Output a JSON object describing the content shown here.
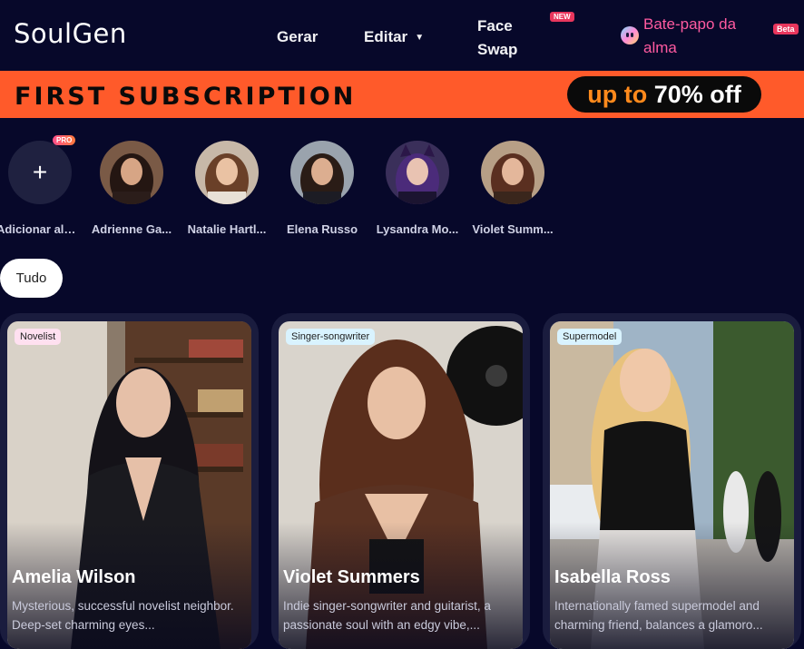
{
  "header": {
    "logo": "SoulGen",
    "nav": {
      "gerar": "Gerar",
      "editar": "Editar",
      "face_swap": "Face Swap",
      "new_badge": "NEW",
      "soul_chat": "Bate-papo da alma",
      "beta_badge": "Beta"
    }
  },
  "banner": {
    "title": "FIRST SUBSCRIPTION",
    "pill_prefix": "up to",
    "pill_value": " 70% off"
  },
  "avatars": {
    "add_label": "Adicionar alm...",
    "pro_badge": "PRO",
    "items": [
      {
        "name": "Adrienne Ga..."
      },
      {
        "name": "Natalie Hartl..."
      },
      {
        "name": "Elena Russo"
      },
      {
        "name": "Lysandra Mo..."
      },
      {
        "name": "Violet Summ..."
      }
    ]
  },
  "filters": {
    "all": "Tudo"
  },
  "cards": [
    {
      "tag": "Novelist",
      "name": "Amelia Wilson",
      "desc": "Mysterious, successful novelist neighbor. Deep-set charming eyes..."
    },
    {
      "tag": "Singer-songwriter",
      "name": "Violet Summers",
      "desc": "Indie singer-songwriter and guitarist, a passionate soul with an edgy vibe,..."
    },
    {
      "tag": "Supermodel",
      "name": "Isabella Ross",
      "desc": "Internationally famed supermodel and charming friend, balances a glamoro..."
    }
  ],
  "colors": {
    "background": "#07082a",
    "banner": "#ff5a2a",
    "accent_pink": "#ff5aa0",
    "badge_red": "#e8365d"
  }
}
